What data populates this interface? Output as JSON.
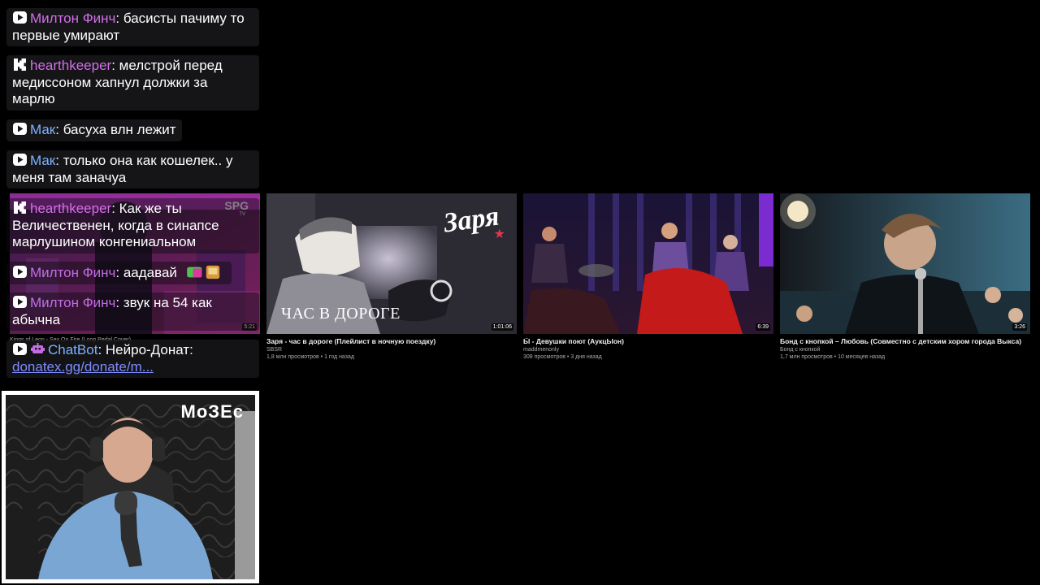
{
  "videos": [
    {
      "title": "Kings of Leon - Sex On Fire (Loop Pedal Cover)",
      "duration": "5:21",
      "thumb_brand": "SPG",
      "thumb_brand_sub": "TV"
    },
    {
      "title": "Заря - час в дороге (Плейлист в ночную поездку)",
      "channel": "SBSR",
      "meta": "1,8 млн просмотров • 1 год назад",
      "duration": "1:01:06",
      "thumb_text": "ЧАС В ДОРОГЕ",
      "thumb_logo": "Заря"
    },
    {
      "title": "Ӹ - Девушки поют (АукцЫон)",
      "channel": "maddmenonly",
      "meta": "308 просмотров • 3 дня назад",
      "duration": "6:39"
    },
    {
      "title": "Бонд с кнопкой – Любовь (Совместно с детским хором города Выкса)",
      "channel": "Бонд с кнопкой",
      "meta": "1,7 млн просмотров • 10 месяцев назад",
      "duration": "3:26"
    }
  ],
  "chat": {
    "messages": [
      {
        "platform": "youtube",
        "nick": "Милтон Финч",
        "text": ": басисты пачиму то первые умирают"
      },
      {
        "platform": "kick",
        "nick": "hearthkeeper",
        "text": ": мелстрой перед медиссоном хапнул должки за марлю"
      },
      {
        "platform": "youtube",
        "nick": "Мак",
        "text": ": басуха влн лежит"
      },
      {
        "platform": "youtube",
        "nick": "Мак",
        "text": ": только она как кошелек.. у меня там заначуа"
      },
      {
        "platform": "kick",
        "nick": "hearthkeeper",
        "text": ": Как же ты Величественен, когда в синапсе марлушином конгениальном"
      },
      {
        "platform": "youtube",
        "nick": "Милтон Финч",
        "text": ": аадавай"
      },
      {
        "platform": "youtube",
        "nick": "Милтон Финч",
        "text": ": звук на 54 как абычна"
      },
      {
        "platform": "youtube",
        "nick": "ChatBot",
        "text": ": Нейро-Донат:",
        "link": "donatex.gg/donate/m..."
      }
    ]
  },
  "webcam": {
    "label": "МоЗЕс"
  },
  "colors": {
    "nick_pink": "#d46fe8",
    "nick_blue": "#7fb2ff",
    "link": "#7c8cff",
    "chat_bg": "#18181b"
  },
  "icons": [
    "youtube-icon",
    "kick-icon",
    "robot-icon",
    "emote-icon"
  ]
}
